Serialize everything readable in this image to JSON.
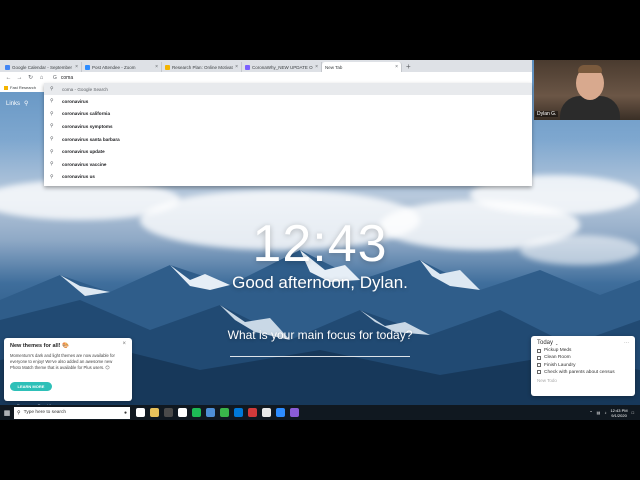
{
  "browser": {
    "tabs": [
      {
        "label": "Google Calendar - September 2",
        "color": "#4285f4"
      },
      {
        "label": "Post Attendee - Zoom",
        "color": "#2d8cff"
      },
      {
        "label": "Research Plan: Online Motivation",
        "color": "#f4b400"
      },
      {
        "label": "CoronaWhy_NEW UPDATE ON !",
        "color": "#7b61ff"
      },
      {
        "label": "New Tab",
        "color": "#dadce0"
      }
    ],
    "new_tab_symbol": "+",
    "tab_close_symbol": "×",
    "omnibox": {
      "prefix": "G",
      "value": "coma"
    },
    "bookmark": "Fast Research"
  },
  "suggestions": {
    "first": "coma - Google Search",
    "items": [
      "coronavirus",
      "coronavirus california",
      "coronavirus symptoms",
      "coronavirus santa barbara",
      "coronavirus update",
      "coronavirus vaccine",
      "coronavirus us"
    ]
  },
  "momentum": {
    "links": "Links",
    "time": "12:43",
    "greeting": "Good afternoon, Dylan.",
    "focus_question": "What is your main focus for today?",
    "footer": "Panorama, Republic"
  },
  "themes_popup": {
    "title": "New themes for all! 🎨",
    "body": "Momentum's dark and light themes are now available for everyone to enjoy! We've also added an awesome new Photo Match theme that is available for Plus users. 😊",
    "button": "LEARN MORE",
    "close": "×"
  },
  "todo": {
    "title": "Today",
    "more": "···",
    "items": [
      "Pickup Meds",
      "Clean Room",
      "Finish Laundry",
      "Check with parents about census"
    ],
    "new_placeholder": "New Todo"
  },
  "taskbar": {
    "search_placeholder": "Type here to search",
    "time": "12:43 PM",
    "date": "9/1/2020",
    "app_colors": [
      "#ffffff",
      "#e8c15a",
      "#4a4a4a",
      "#ffffff",
      "#1db954",
      "#4e8fd6",
      "#39b54a",
      "#0078d7",
      "#d23a3a",
      "#e8e8e8",
      "#2d8cff",
      "#8a5cd6"
    ]
  },
  "webcam": {
    "name": "Dylan G."
  }
}
